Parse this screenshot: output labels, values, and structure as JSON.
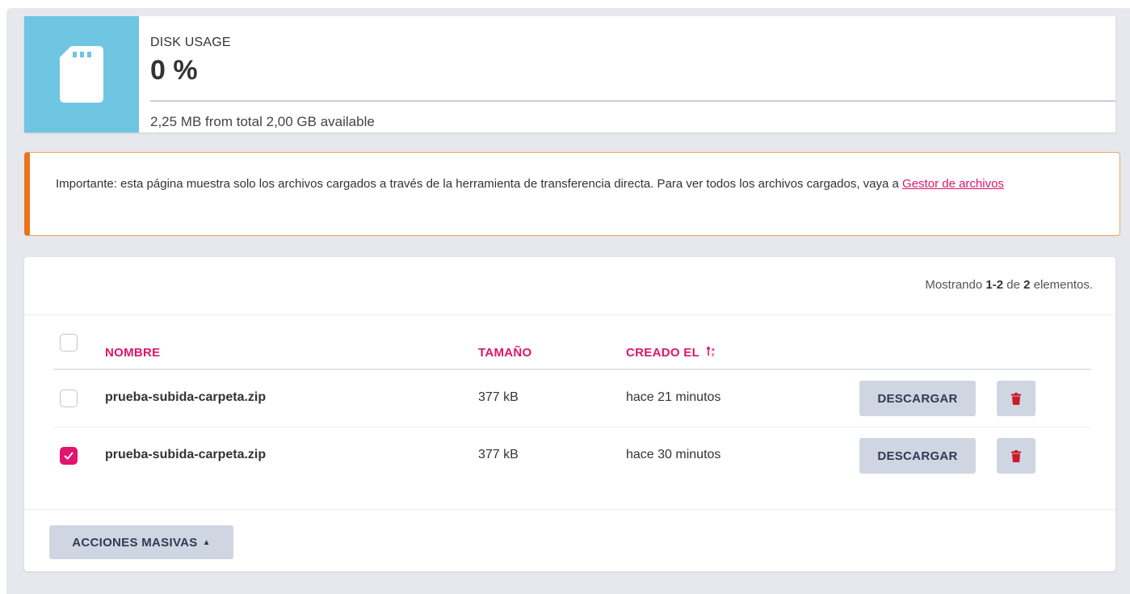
{
  "disk": {
    "label": "DISK USAGE",
    "value": "0 %",
    "percent": 0,
    "detail": "2,25 MB from total 2,00 GB available",
    "icon": "sd-card-icon",
    "accent": "#6ec6e2"
  },
  "notice": {
    "text": "Importante: esta página muestra solo los archivos cargados a través de la herramienta de transferencia directa. Para ver todos los archivos cargados, vaya a ",
    "link_text": "Gestor de archivos",
    "accent": "#e8741e"
  },
  "summary": {
    "prefix": "Mostrando ",
    "range": "1-2",
    "middle": " de ",
    "total": "2",
    "suffix": " elementos."
  },
  "table": {
    "columns": {
      "name": "NOMBRE",
      "size": "TAMAÑO",
      "created": "CREADO EL"
    },
    "sort_icon": "sort-icon",
    "rows": [
      {
        "name": "prueba-subida-carpeta.zip",
        "size": "377 kB",
        "created": "hace 21 minutos",
        "download_label": "DESCARGAR",
        "checked": false
      },
      {
        "name": "prueba-subida-carpeta.zip",
        "size": "377 kB",
        "created": "hace 30 minutos",
        "download_label": "DESCARGAR",
        "checked": true
      }
    ]
  },
  "bulk": {
    "label": "ACCIONES MASIVAS",
    "icon": "caret-up-icon"
  },
  "colors": {
    "brand": "#e0156b",
    "button_bg": "#cfd6e2",
    "button_text": "#2f3b52",
    "trash_icon": "#cc1b2a"
  }
}
